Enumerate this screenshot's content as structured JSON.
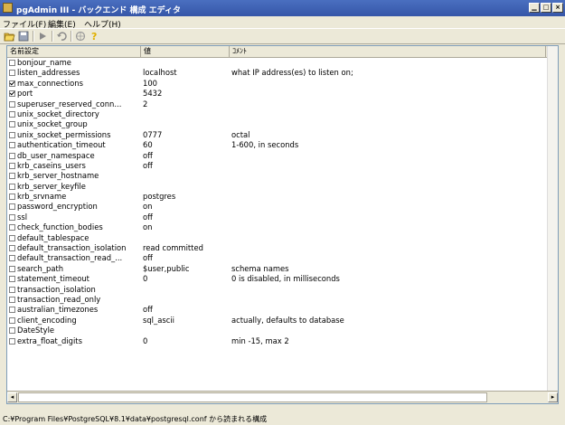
{
  "window": {
    "title": "pgAdmin III - バックエンド 構成 エディタ"
  },
  "menu": [
    "ファイル(F)",
    "編集(E)",
    "ヘルプ(H)"
  ],
  "toolbar": {
    "icons": [
      "open-icon",
      "save-icon",
      "execute-icon",
      "undo-icon",
      "hint-icon",
      "help-icon"
    ]
  },
  "columns": {
    "name": "名前設定",
    "value": "値",
    "comment": "ｺﾒﾝﾄ"
  },
  "rows": [
    {
      "checked": false,
      "name": "bonjour_name",
      "value": "",
      "comment": ""
    },
    {
      "checked": false,
      "name": "listen_addresses",
      "value": "localhost",
      "comment": "what IP address(es) to listen on;"
    },
    {
      "checked": true,
      "name": "max_connections",
      "value": "100",
      "comment": ""
    },
    {
      "checked": true,
      "name": "port",
      "value": "5432",
      "comment": ""
    },
    {
      "checked": false,
      "name": "superuser_reserved_conn...",
      "value": "2",
      "comment": ""
    },
    {
      "checked": false,
      "name": "unix_socket_directory",
      "value": "",
      "comment": ""
    },
    {
      "checked": false,
      "name": "unix_socket_group",
      "value": "",
      "comment": ""
    },
    {
      "checked": false,
      "name": "unix_socket_permissions",
      "value": "0777",
      "comment": "octal"
    },
    {
      "checked": false,
      "name": "authentication_timeout",
      "value": "60",
      "comment": "1-600, in seconds"
    },
    {
      "checked": false,
      "name": "db_user_namespace",
      "value": "off",
      "comment": ""
    },
    {
      "checked": false,
      "name": "krb_caseins_users",
      "value": "off",
      "comment": ""
    },
    {
      "checked": false,
      "name": "krb_server_hostname",
      "value": "",
      "comment": ""
    },
    {
      "checked": false,
      "name": "krb_server_keyfile",
      "value": "",
      "comment": ""
    },
    {
      "checked": false,
      "name": "krb_srvname",
      "value": "postgres",
      "comment": ""
    },
    {
      "checked": false,
      "name": "password_encryption",
      "value": "on",
      "comment": ""
    },
    {
      "checked": false,
      "name": "ssl",
      "value": "off",
      "comment": ""
    },
    {
      "checked": false,
      "name": "check_function_bodies",
      "value": "on",
      "comment": ""
    },
    {
      "checked": false,
      "name": "default_tablespace",
      "value": "",
      "comment": ""
    },
    {
      "checked": false,
      "name": "default_transaction_isolation",
      "value": "read committed",
      "comment": ""
    },
    {
      "checked": false,
      "name": "default_transaction_read_...",
      "value": "off",
      "comment": ""
    },
    {
      "checked": false,
      "name": "search_path",
      "value": "$user,public",
      "comment": "schema names"
    },
    {
      "checked": false,
      "name": "statement_timeout",
      "value": "0",
      "comment": "0 is disabled, in milliseconds"
    },
    {
      "checked": false,
      "name": "transaction_isolation",
      "value": "",
      "comment": ""
    },
    {
      "checked": false,
      "name": "transaction_read_only",
      "value": "",
      "comment": ""
    },
    {
      "checked": false,
      "name": "australian_timezones",
      "value": "off",
      "comment": ""
    },
    {
      "checked": false,
      "name": "client_encoding",
      "value": "sql_ascii",
      "comment": "actually, defaults to database"
    },
    {
      "checked": false,
      "name": "DateStyle",
      "value": "",
      "comment": ""
    },
    {
      "checked": false,
      "name": "extra_float_digits",
      "value": "0",
      "comment": "min -15, max 2"
    }
  ],
  "status": {
    "text": "C:¥Program Files¥PostgreSQL¥8.1¥data¥postgresql.conf から読まれる構成"
  }
}
